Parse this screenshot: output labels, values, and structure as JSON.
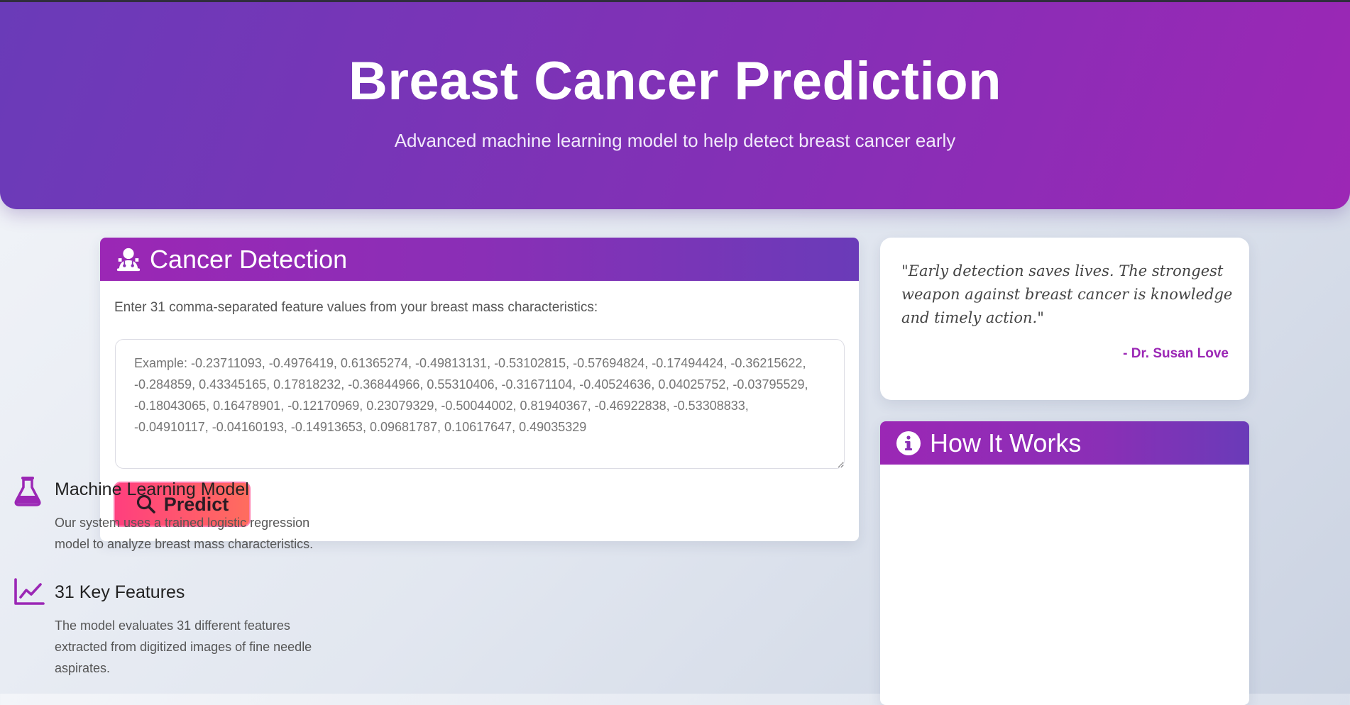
{
  "hero": {
    "title": "Breast Cancer Prediction",
    "subtitle": "Advanced machine learning model to help detect breast cancer early"
  },
  "detection": {
    "heading": "Cancer Detection",
    "heading_icon": "user-doctor-icon",
    "instruction": "Enter 31 comma-separated feature values from your breast mass characteristics:",
    "input_value": "",
    "input_placeholder": "Example: -0.23711093, -0.4976419, 0.61365274, -0.49813131, -0.53102815, -0.57694824, -0.17494424, -0.36215622, -0.284859, 0.43345165, 0.17818232, -0.36844966, 0.55310406, -0.31671104, -0.40524636, 0.04025752, -0.03795529, -0.18043065, 0.16478901, -0.12170969, 0.23079329, -0.50044002, 0.81940367, -0.46922838, -0.53308833, -0.04910117, -0.04160193, -0.14913653, 0.09681787, 0.10617647, 0.49035329",
    "button_label": "Predict",
    "button_icon": "search-icon"
  },
  "quote": {
    "text": "\"Early detection saves lives. The strongest weapon against breast cancer is knowledge and timely action.\"",
    "author": "- Dr. Susan Love"
  },
  "how_it_works": {
    "heading": "How It Works",
    "heading_icon": "info-circle-icon",
    "items": [
      {
        "icon": "flask-icon",
        "title": "Machine Learning Model",
        "description": "Our system uses a trained logistic regression model to analyze breast mass characteristics."
      },
      {
        "icon": "chart-line-icon",
        "title": "31 Key Features",
        "description": "The model evaluates 31 different features extracted from digitized images of fine needle aspirates."
      }
    ]
  },
  "colors": {
    "primary_purple": "#9b27b5",
    "indigo": "#6a3bb8",
    "button_pink": "#ff3f7e",
    "button_coral": "#ff6d5e"
  }
}
